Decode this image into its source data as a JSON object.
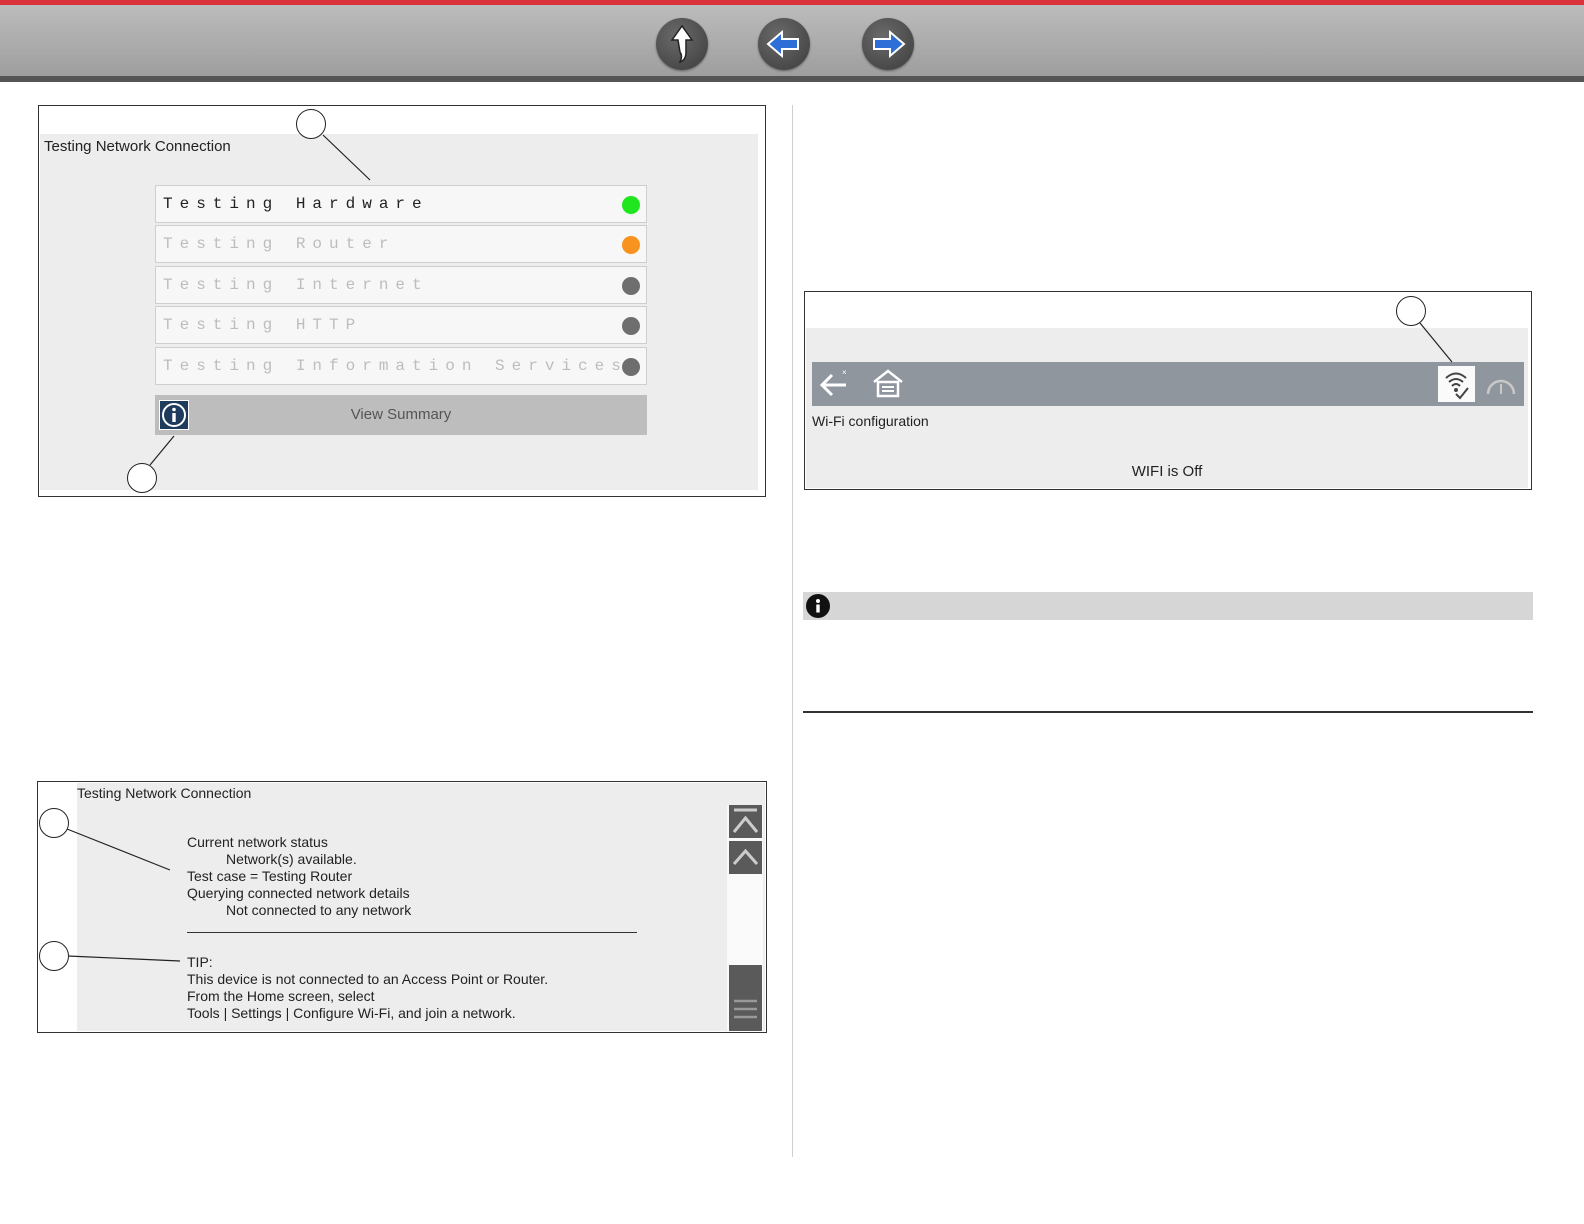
{
  "nav": {
    "up_icon": "up-arrow-icon",
    "back_icon": "left-arrow-icon",
    "forward_icon": "right-arrow-icon",
    "accent_color": "#d9323a"
  },
  "figure_tests": {
    "title": "Testing Network Connection",
    "tests": [
      {
        "label": "Testing Hardware",
        "status_color": "#1fe61f"
      },
      {
        "label": "Testing Router",
        "status_color": "#f7931e"
      },
      {
        "label": "Testing Internet",
        "status_color": "#6e6e6e"
      },
      {
        "label": "Testing HTTP",
        "status_color": "#6e6e6e"
      },
      {
        "label": "Testing Information Services",
        "status_color": "#6e6e6e"
      }
    ],
    "summary_button": "View Summary"
  },
  "figure_summary": {
    "title": "Testing Network Connection",
    "lines": [
      "Current network status",
      "Network(s) available.",
      "Test case = Testing Router",
      "Querying connected network details",
      "Not connected to any network"
    ],
    "tip": [
      "TIP:",
      "This device is not connected to an Access Point or Router.",
      "From the Home screen, select",
      "Tools | Settings | Configure Wi-Fi, and join a network."
    ]
  },
  "figure_wifi": {
    "screen_title": "Wi-Fi configuration",
    "status": "WIFI is Off"
  }
}
